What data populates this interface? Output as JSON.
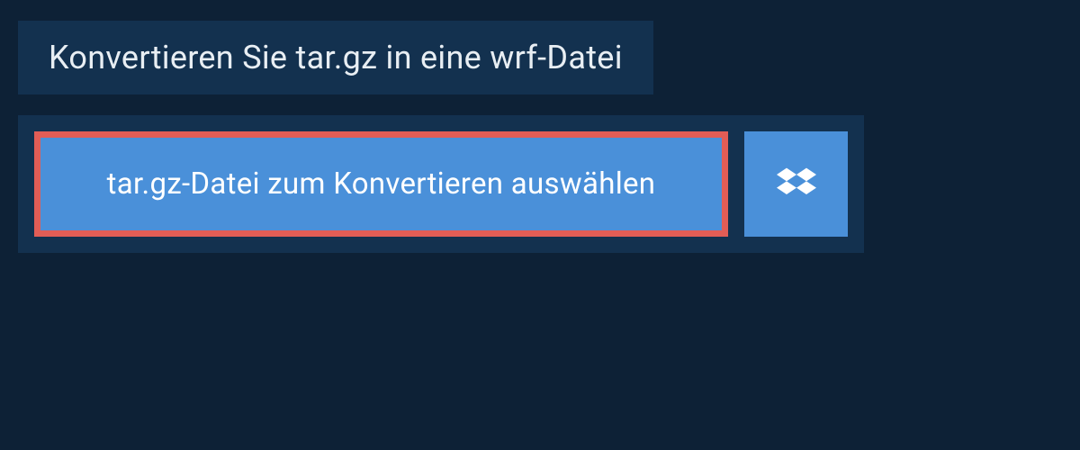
{
  "header": {
    "title": "Konvertieren Sie tar.gz in eine wrf-Datei"
  },
  "upload": {
    "select_file_label": "tar.gz-Datei zum Konvertieren auswählen",
    "dropbox_icon": "dropbox-icon"
  },
  "colors": {
    "background": "#0d2136",
    "panel": "#13314f",
    "button_primary": "#4a90d9",
    "highlight_border": "#e25d56",
    "text_light": "#e8eef3",
    "text_white": "#ffffff"
  }
}
